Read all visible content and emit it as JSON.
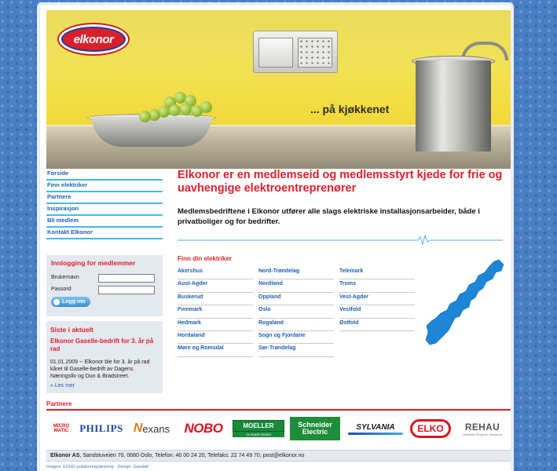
{
  "brand": {
    "logo_text": "elkonor"
  },
  "hero": {
    "slogan": "... på kjøkkenet"
  },
  "nav": {
    "items": [
      "Forside",
      "Finn elektriker",
      "Partnere",
      "Inspirasjon",
      "Bli medlem",
      "Kontakt Elkonor"
    ]
  },
  "login": {
    "title": "Innlogging for medlemmer",
    "username_label": "Brukernavn",
    "password_label": "Passord",
    "username_value": "",
    "password_value": "",
    "button_label": "Logg inn"
  },
  "news": {
    "title": "Siste i aktuelt",
    "headline": "Elkonor Gaselle-bedrift for 3. år på rad",
    "text": "01.01.2009 -- Elkonor ble for 3. år på rad kåret til Gaselle-bedrift av Dagens Næringsliv og Dun & Bradstreet.",
    "more_link": "» Les mer"
  },
  "main": {
    "headline": "Elkonor er en medlemseid og medlemsstyrt kjede for frie og uavhengige elektroentreprenører",
    "intro": "Medlemsbedriftene i Elkonor utfører alle slags elektriske installasjonsarbeider, både i privatboliger og for bedrifter."
  },
  "finn": {
    "title": "Finn din elektriker",
    "columns": [
      [
        "Akershus",
        "Aust-Agder",
        "Buskerud",
        "Finnmark",
        "Hedmark",
        "Hordaland",
        "Møre og Romsdal"
      ],
      [
        "Nord-Trøndelag",
        "Nordland",
        "Oppland",
        "Oslo",
        "Rogaland",
        "Sogn og Fjordane",
        "Sør-Trøndelag"
      ],
      [
        "Telemark",
        "Troms",
        "Vest-Agder",
        "Vestfold",
        "Østfold"
      ]
    ]
  },
  "partners": {
    "title": "Partnere",
    "logos": {
      "micromatic_1": "MICRO",
      "micromatic_2": "MATIC",
      "philips": "PHILIPS",
      "nexans_n": "N",
      "nexans_rest": "exans",
      "nobo": "NOBO",
      "moeller": "MOELLER",
      "moeller_sub": "An Eaton Brand",
      "schneider_1": "Schneider",
      "schneider_2": "Electric",
      "sylvania": "SYLVANIA",
      "elko": "ELKO",
      "rehau": "REHAU",
      "rehau_tag": "Unlimited Polymer Solutions"
    }
  },
  "footer": {
    "company": "Elkonor AS",
    "details": ", Sandstuveien 70, 0680 Oslo, Telefon: 40 00 24 20, Telefaks: 22 74 49 70, post@elkonor.no",
    "credits": "Images: ECHO publiseringsløsning - Design: Gandalf"
  },
  "colors": {
    "accent_red": "#e01e2c",
    "link_blue": "#1f5fb3",
    "divider_cyan": "#47b8e6",
    "map_blue": "#1e86d6"
  }
}
